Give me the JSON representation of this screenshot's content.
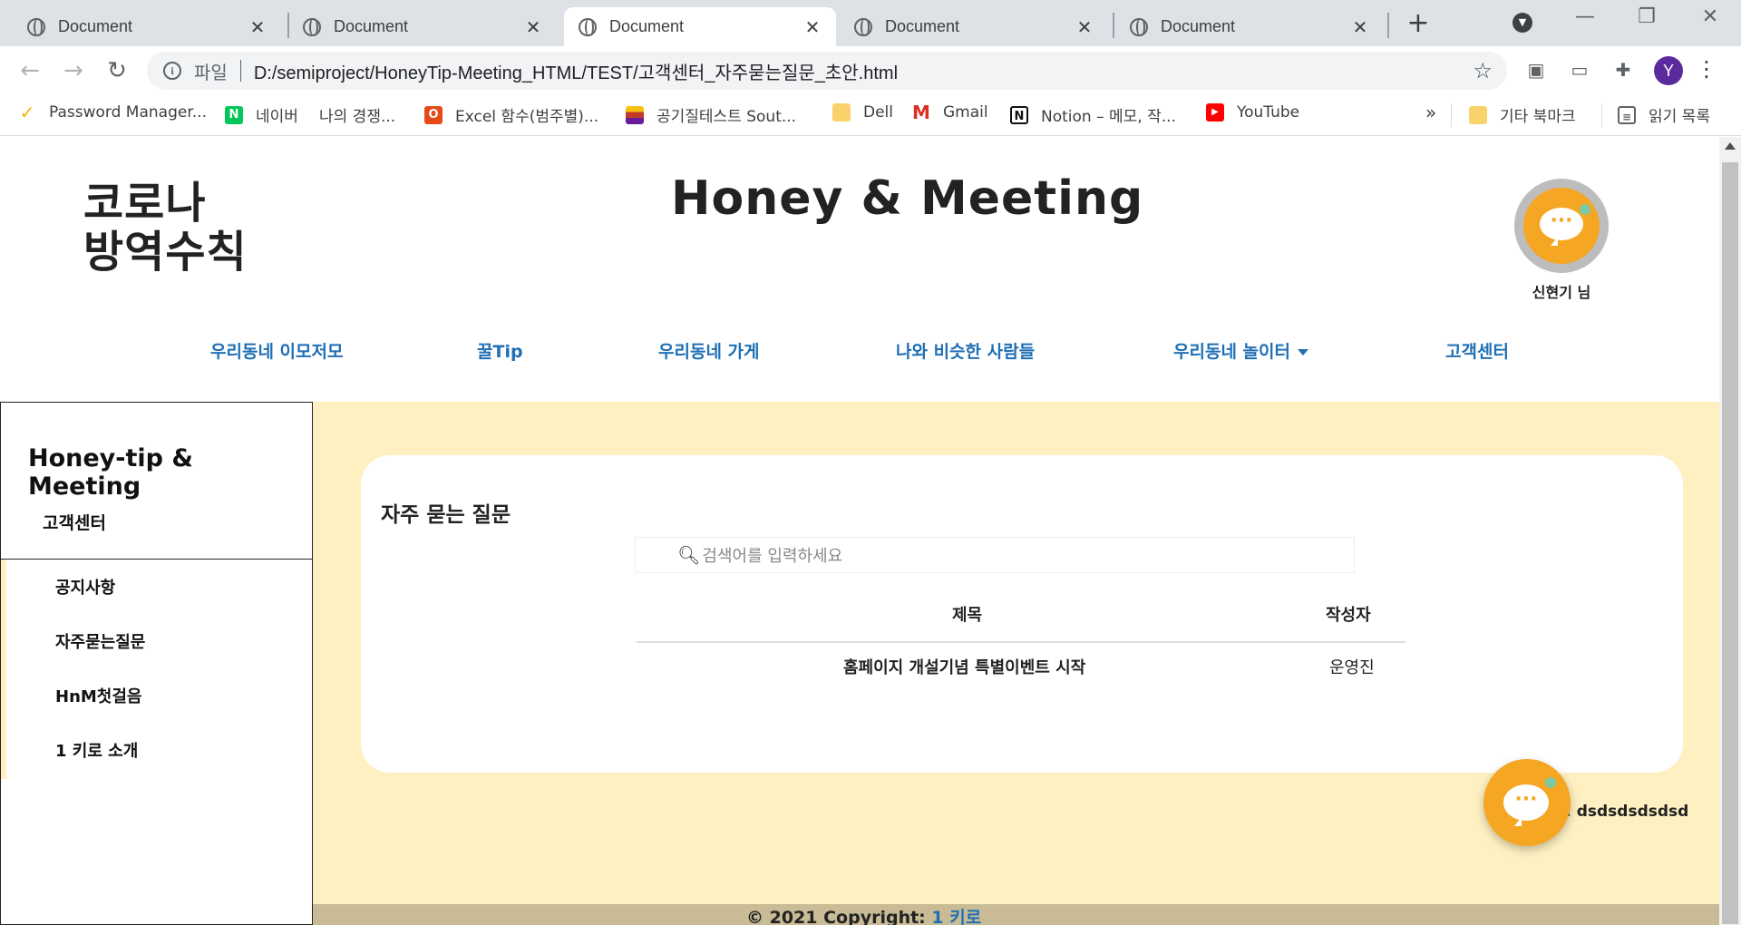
{
  "browser": {
    "tabs": [
      {
        "title": "Document",
        "active": false
      },
      {
        "title": "Document",
        "active": false
      },
      {
        "title": "Document",
        "active": true
      },
      {
        "title": "Document",
        "active": false
      },
      {
        "title": "Document",
        "active": false
      }
    ],
    "omnibox": {
      "scheme_label": "파일",
      "url": "D:/semiproject/HoneyTip-Meeting_HTML/TEST/고객센터_자주묻는질문_초안.html"
    },
    "profile_initial": "Y",
    "bookmarks": [
      {
        "label": "Password Manager...",
        "icon": "password-manager-icon"
      },
      {
        "label": "네이버",
        "icon": "naver-icon"
      },
      {
        "label": "나의 경쟁...",
        "icon": "none"
      },
      {
        "label": "Excel 함수(범주별)...",
        "icon": "office-icon"
      },
      {
        "label": "공기질테스트 Sout...",
        "icon": "site-icon"
      },
      {
        "label": "Dell",
        "icon": "folder-icon"
      },
      {
        "label": "Gmail",
        "icon": "gmail-icon"
      },
      {
        "label": "Notion – 메모, 작...",
        "icon": "notion-icon"
      },
      {
        "label": "YouTube",
        "icon": "youtube-icon"
      }
    ],
    "overflow_label": "»",
    "other_bookmarks": "기타 북마크",
    "reading_list": "읽기 목록"
  },
  "page": {
    "corona_line1": "코로나",
    "corona_line2": "방역수칙",
    "site_title": "Honey & Meeting",
    "user_name": "신현기 님",
    "nav": [
      "우리동네 이모저모",
      "꿀Tip",
      "우리동네 가게",
      "나와 비슷한 사람들",
      "우리동네 놀이터",
      "고객센터"
    ],
    "sidebar": {
      "title": "Honey-tip & Meeting",
      "subtitle": "고객센터",
      "items": [
        "공지사항",
        "자주묻는질문",
        "HnM첫걸음",
        "1 키로 소개"
      ]
    },
    "faq": {
      "title": "자주 묻는 질문",
      "search_placeholder": "검색어를 입력하세요",
      "columns": [
        "제목",
        "작성자"
      ],
      "rows": [
        {
          "title": "홈페이지 개설기념 특별이벤트 시작",
          "author": "운영진"
        }
      ]
    },
    "float_chat_text": ": dsdsdsdsdsd",
    "footer": {
      "text": "© 2021 Copyright: ",
      "link": "1 키로"
    }
  }
}
